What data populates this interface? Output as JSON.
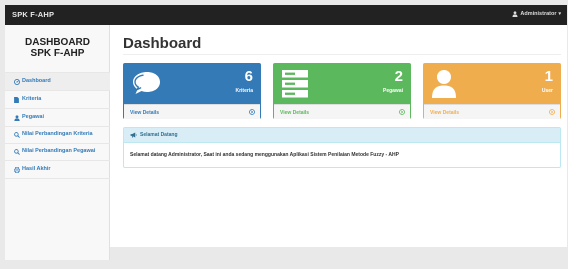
{
  "topbar": {
    "brand": "SPK F-AHP",
    "user_label": "Administrator",
    "user_icon": "user-icon",
    "caret": "▾"
  },
  "sidebar": {
    "title_line1": "DASHBOARD",
    "title_line2": "SPK F-AHP",
    "items": [
      {
        "label": "Dashboard",
        "icon": "dashboard-icon",
        "active": true
      },
      {
        "label": "Kriteria",
        "icon": "document-icon"
      },
      {
        "label": "Pegawai",
        "icon": "user-icon"
      },
      {
        "label": "Nilai Perbandingan Kriteria",
        "icon": "search-icon"
      },
      {
        "label": "Nilai Perbandingan Pegawai",
        "icon": "search-icon"
      },
      {
        "label": "Hasil Akhir",
        "icon": "print-icon"
      }
    ]
  },
  "main": {
    "title": "Dashboard",
    "cards": [
      {
        "count": "6",
        "label": "Kriteria",
        "link": "View Details",
        "icon": "comments-icon",
        "color": "#337ab7",
        "text_color": "#337ab7"
      },
      {
        "count": "2",
        "label": "Pegawai",
        "link": "View Details",
        "icon": "server-icon",
        "color": "#5cb85c",
        "text_color": "#5cb85c"
      },
      {
        "count": "1",
        "label": "User",
        "link": "View Details",
        "icon": "user-icon",
        "color": "#f0ad4e",
        "text_color": "#f0ad4e"
      }
    ],
    "panel": {
      "title": "Selamat Datang",
      "icon": "bullhorn-icon",
      "message": "Selamat datang Administrator, Saat ini anda sedang menggunakan Aplikasi Sistem Penilaian Metode Fuzzy - AHP"
    }
  },
  "colors": {
    "topbar": "#222222",
    "link": "#337ab7",
    "panel_head": "#d9edf7",
    "panel_text": "#31708f"
  }
}
